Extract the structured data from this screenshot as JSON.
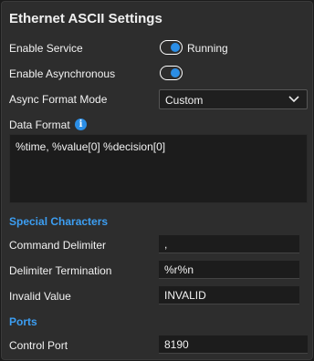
{
  "panel": {
    "title": "Ethernet ASCII Settings"
  },
  "enable_service": {
    "label": "Enable Service",
    "status_text": "Running"
  },
  "enable_async": {
    "label": "Enable Asynchronous"
  },
  "async_format": {
    "label": "Async Format Mode",
    "selected": "Custom"
  },
  "data_format": {
    "label": "Data Format",
    "info_glyph": "i",
    "value": "%time, %value[0] %decision[0]"
  },
  "special_characters": {
    "heading": "Special Characters",
    "command_delimiter": {
      "label": "Command Delimiter",
      "value": ","
    },
    "delimiter_termination": {
      "label": "Delimiter Termination",
      "value": "%r%n"
    },
    "invalid_value": {
      "label": "Invalid Value",
      "value": "INVALID"
    }
  },
  "ports": {
    "heading": "Ports",
    "control_port": {
      "label": "Control Port",
      "value": "8190"
    }
  },
  "colors": {
    "accent": "#2b8ee6",
    "section_heading": "#3c9ef2",
    "panel_bg": "#2d2d2d",
    "field_bg": "#1c1c1c"
  }
}
